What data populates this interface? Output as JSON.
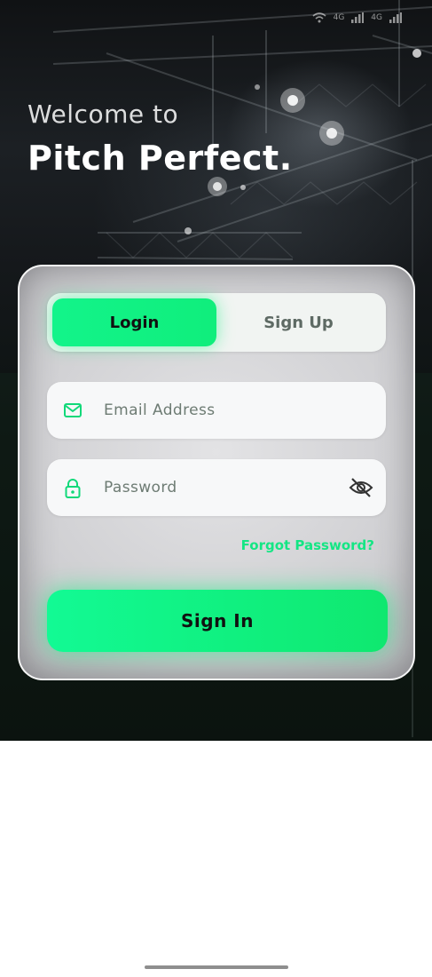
{
  "status_bar": {
    "network_1": "4G",
    "network_2": "4G"
  },
  "hero": {
    "welcome_text": "Welcome to",
    "app_name": "Pitch Perfect."
  },
  "auth": {
    "tabs": [
      {
        "label": "Login",
        "active": true
      },
      {
        "label": "Sign Up",
        "active": false
      }
    ],
    "email": {
      "placeholder": "Email Address",
      "value": "",
      "icon": "mail-icon"
    },
    "password": {
      "placeholder": "Password",
      "value": "",
      "icon": "lock-icon",
      "toggle_icon": "eye-off-icon"
    },
    "forgot_password_label": "Forgot Password?",
    "submit_label": "Sign In"
  },
  "colors": {
    "accent": "#12f48a",
    "accent_dark": "#0fe86f",
    "text_dark": "#111111",
    "placeholder": "#6d7b73"
  }
}
